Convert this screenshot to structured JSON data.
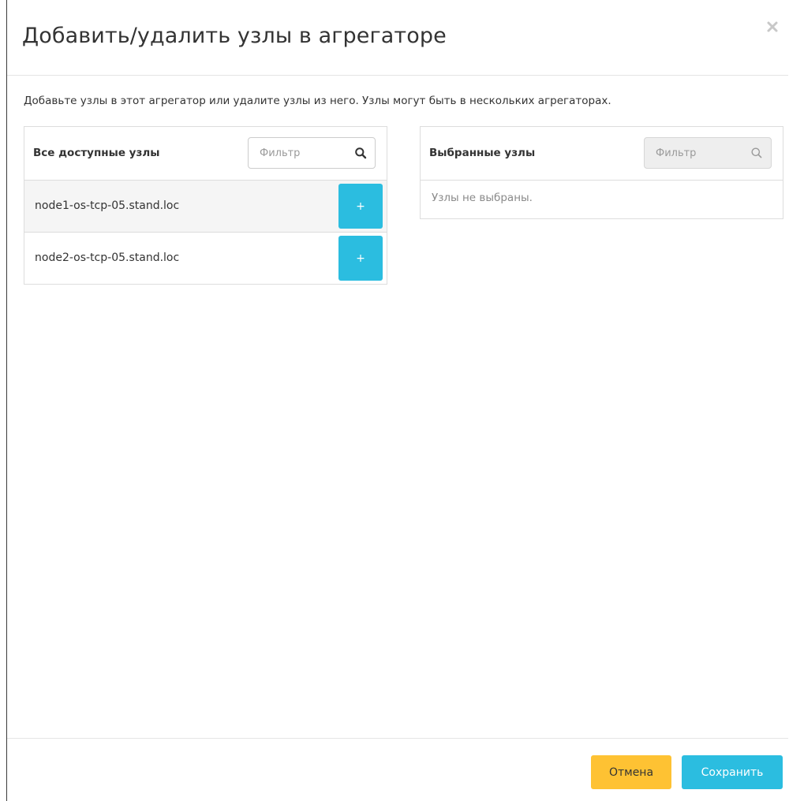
{
  "modal": {
    "title": "Добавить/удалить узлы в агрегаторе",
    "close_icon": "close-icon",
    "description": "Добавьте узлы в этот агрегатор или удалите узлы из него. Узлы могут быть в нескольких агрегаторах."
  },
  "available": {
    "title": "Все доступные узлы",
    "filter_placeholder": "Фильтр",
    "items": [
      {
        "label": "node1-os-tcp-05.stand.loc",
        "button": "+"
      },
      {
        "label": "node2-os-tcp-05.stand.loc",
        "button": "+"
      }
    ]
  },
  "selected": {
    "title": "Выбранные узлы",
    "filter_placeholder": "Фильтр",
    "empty_text": "Узлы не выбраны."
  },
  "footer": {
    "cancel_label": "Отмена",
    "save_label": "Сохранить"
  },
  "colors": {
    "primary": "#2bbde0",
    "warning": "#fec233"
  }
}
